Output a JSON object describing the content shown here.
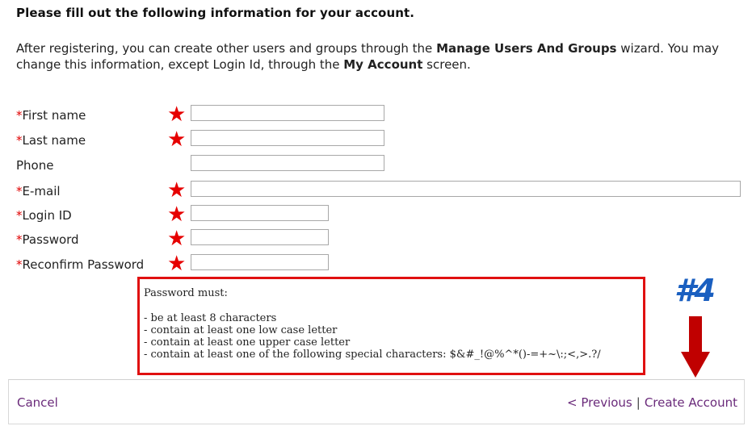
{
  "heading": "Please fill out the following information for your account.",
  "intro": {
    "part1": "After registering, you can create other users and groups through the ",
    "bold1": "Manage Users And Groups",
    "part2": " wizard. You may change this information, except Login Id, through the ",
    "bold2": "My Account",
    "part3": " screen."
  },
  "form": {
    "required_marker": "*",
    "fields": [
      {
        "label": "First name",
        "required": true,
        "value": ""
      },
      {
        "label": "Last name",
        "required": true,
        "value": ""
      },
      {
        "label": "Phone",
        "required": false,
        "value": ""
      },
      {
        "label": "E-mail",
        "required": true,
        "value": ""
      },
      {
        "label": "Login ID",
        "required": true,
        "value": ""
      },
      {
        "label": "Password",
        "required": true,
        "value": ""
      },
      {
        "label": "Reconfirm Password",
        "required": true,
        "value": ""
      }
    ]
  },
  "annotation": {
    "star_glyph": "★",
    "star_color": "#e60000",
    "step_label": "#4",
    "step_color": "#1a5fc0",
    "arrow_color": "#c00000",
    "highlight_color": "#e01010"
  },
  "password_rules": {
    "title": "Password must:",
    "rules": [
      "- be at least 8 characters",
      "- contain at least one low case letter",
      "- contain at least one upper case letter",
      "- contain at least one of the following special characters: $&#_!@%^*()-=+~\\:;<,>.?/"
    ]
  },
  "footer": {
    "cancel_label": "Cancel",
    "previous_label": "< Previous",
    "separator": "|",
    "create_label": "Create Account"
  }
}
